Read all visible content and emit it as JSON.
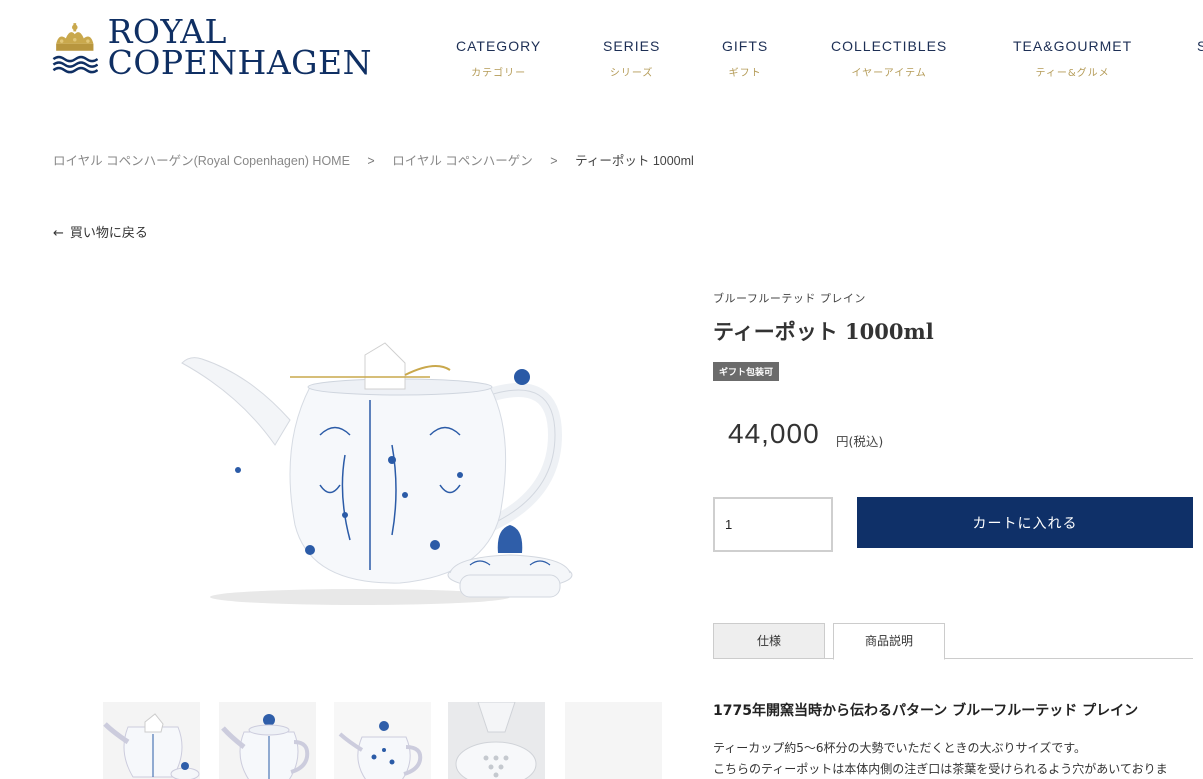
{
  "header": {
    "logo_line1": "ROYAL",
    "logo_line2": "COPENHAGEN",
    "nav": [
      {
        "en": "CATEGORY",
        "jp": "カテゴリー"
      },
      {
        "en": "SERIES",
        "jp": "シリーズ"
      },
      {
        "en": "GIFTS",
        "jp": "ギフト"
      },
      {
        "en": "COLLECTIBLES",
        "jp": "イヤーアイテム"
      },
      {
        "en": "TEA&GOURMET",
        "jp": "ティー&グルメ"
      },
      {
        "en": "S",
        "jp": ""
      }
    ]
  },
  "breadcrumb": {
    "items": [
      "ロイヤル コペンハーゲン(Royal Copenhagen) HOME",
      "ロイヤル コペンハーゲン",
      "ティーポット 1000ml"
    ],
    "separator": ">"
  },
  "back_link": {
    "arrow": "←",
    "label": "買い物に戻る"
  },
  "product": {
    "series": "ブルーフルーテッド プレイン",
    "title": "ティーポット 1000ml",
    "badge": "ギフト包装可",
    "price": "44,000",
    "price_unit": "円(税込)",
    "quantity": "1",
    "cart_button": "カートに入れる"
  },
  "tabs": [
    {
      "label": "仕様",
      "active": false
    },
    {
      "label": "商品説明",
      "active": true
    }
  ],
  "description": {
    "title": "1775年開窯当時から伝わるパターン ブルーフルーテッド プレイン",
    "lines": [
      "ティーカップ約5～6杯分の大勢でいただくときの大ぶりサイズです。",
      "こちらのティーポットは本体内側の注ぎ口は茶葉を受けられるよう穴があいておりま"
    ]
  },
  "colors": {
    "brand_navy": "#0f3068",
    "gold": "#b49b57",
    "badge_gray": "#6b6b6b"
  }
}
